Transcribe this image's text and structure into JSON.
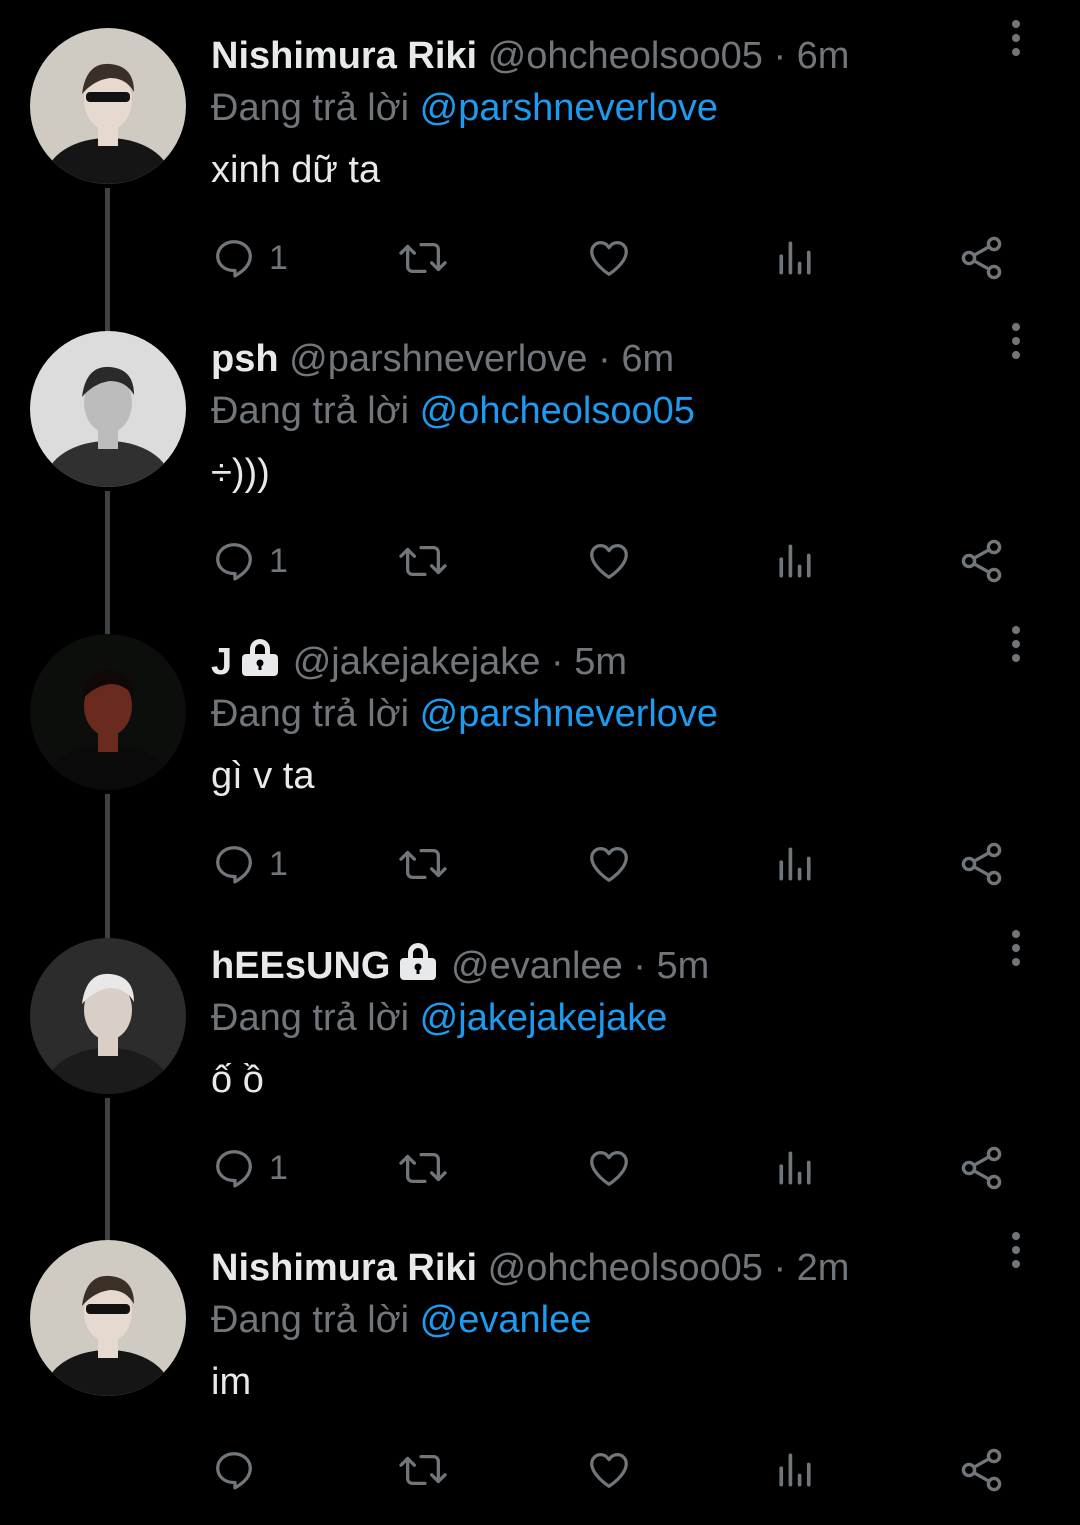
{
  "colors": {
    "background": "#000000",
    "text_primary": "#e7e9ea",
    "text_secondary": "#71767b",
    "accent_link": "#1d9bf0",
    "thread_line": "#3e4144"
  },
  "reply_prefix": "Đang trả lời",
  "tweets": [
    {
      "name": "Nishimura Riki",
      "locked": false,
      "handle": "@ohcheolsoo05",
      "separator": "·",
      "time": "6m",
      "reply_to": "@parshneverlove",
      "text": "xinh dữ ta",
      "reply_count": "1",
      "icons": [
        "reply-icon",
        "retweet-icon",
        "like-icon",
        "views-icon",
        "share-icon",
        "more-icon"
      ]
    },
    {
      "name": "psh",
      "locked": false,
      "handle": "@parshneverlove",
      "separator": "·",
      "time": "6m",
      "reply_to": "@ohcheolsoo05",
      "text": "÷)))",
      "reply_count": "1",
      "icons": [
        "reply-icon",
        "retweet-icon",
        "like-icon",
        "views-icon",
        "share-icon",
        "more-icon"
      ]
    },
    {
      "name": "J",
      "locked": true,
      "handle": "@jakejakejake",
      "separator": "·",
      "time": "5m",
      "reply_to": "@parshneverlove",
      "text": "gì v ta",
      "reply_count": "1",
      "icons": [
        "reply-icon",
        "retweet-icon",
        "like-icon",
        "views-icon",
        "share-icon",
        "more-icon"
      ]
    },
    {
      "name": "hEEsUNG",
      "locked": true,
      "handle": "@evanlee",
      "separator": "·",
      "time": "5m",
      "reply_to": "@jakejakejake",
      "text": "ố ồ",
      "reply_count": "1",
      "icons": [
        "reply-icon",
        "retweet-icon",
        "like-icon",
        "views-icon",
        "share-icon",
        "more-icon"
      ]
    },
    {
      "name": "Nishimura Riki",
      "locked": false,
      "handle": "@ohcheolsoo05",
      "separator": "·",
      "time": "2m",
      "reply_to": "@evanlee",
      "text": "im",
      "reply_count": "",
      "icons": [
        "reply-icon",
        "retweet-icon",
        "like-icon",
        "views-icon",
        "share-icon",
        "more-icon"
      ]
    }
  ]
}
